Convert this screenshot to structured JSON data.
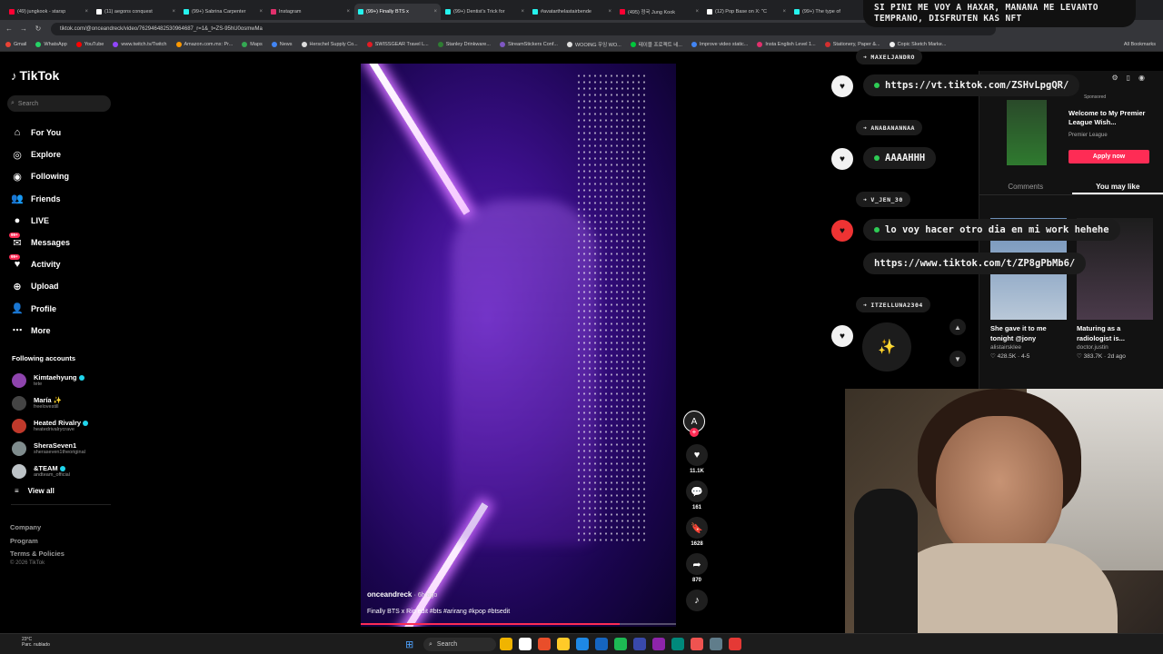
{
  "browser": {
    "tabs": [
      {
        "label": "(49) jungkook - starsp",
        "color": "#ff0033",
        "active": false
      },
      {
        "label": "(11) aegons conquest",
        "color": "#ffffff",
        "active": false
      },
      {
        "label": "(99+) Sabrina Carpenter",
        "color": "#25f4ee",
        "active": false
      },
      {
        "label": "Instagram",
        "color": "#e1306c",
        "active": false
      },
      {
        "label": "(99+) Finally BTS x",
        "color": "#25f4ee",
        "active": true
      },
      {
        "label": "(99+) Dentist's Trick for",
        "color": "#25f4ee",
        "active": false
      },
      {
        "label": "#avatarthelastairbende",
        "color": "#25f4ee",
        "active": false
      },
      {
        "label": "(495) 정국 Jung Kook",
        "color": "#ff0033",
        "active": false
      },
      {
        "label": "(12) Pop Base on X: \"C",
        "color": "#ffffff",
        "active": false
      },
      {
        "label": "(99+) The type of",
        "color": "#25f4ee",
        "active": false
      }
    ],
    "url": "tiktok.com/@onceandreck/video/762946482530964687_r=1&_t=ZS-95hU0osmwMa",
    "bookmarks": [
      {
        "label": "Gmail",
        "color": "#ea4335"
      },
      {
        "label": "WhatsApp",
        "color": "#25d366"
      },
      {
        "label": "YouTube",
        "color": "#ff0000"
      },
      {
        "label": "www.twitch.tv/Twitch",
        "color": "#9146ff"
      },
      {
        "label": "Amazon.com.mx: Pr...",
        "color": "#ff9900"
      },
      {
        "label": "Maps",
        "color": "#34a853"
      },
      {
        "label": "News",
        "color": "#4285f4"
      },
      {
        "label": "Herschel Supply Co...",
        "color": "#dddddd"
      },
      {
        "label": "SWISSGEAR Travel L...",
        "color": "#e31b23"
      },
      {
        "label": "Stanley Drinkware...",
        "color": "#2e7d32"
      },
      {
        "label": "StreamStickers Conf...",
        "color": "#7e57c2"
      },
      {
        "label": "WOOING 우잉 WO...",
        "color": "#e0e0e0"
      },
      {
        "label": "테이블 프로젝트 네...",
        "color": "#00c73c"
      },
      {
        "label": "Improve video static...",
        "color": "#4285f4"
      },
      {
        "label": "Insta English Level 1...",
        "color": "#e1306c"
      },
      {
        "label": "Stationery, Paper &...",
        "color": "#d32f2f"
      },
      {
        "label": "Copic Sketch Marke...",
        "color": "#eeeeee"
      }
    ],
    "all_bookmarks": "All Bookmarks"
  },
  "tiktok": {
    "logo": "TikTok",
    "search_placeholder": "Search",
    "menu": [
      {
        "label": "For You",
        "icon": "home-icon",
        "glyph": "⌂",
        "badge": ""
      },
      {
        "label": "Explore",
        "icon": "compass-icon",
        "glyph": "◎",
        "badge": ""
      },
      {
        "label": "Following",
        "icon": "following-icon",
        "glyph": "◉",
        "badge": ""
      },
      {
        "label": "Friends",
        "icon": "friends-icon",
        "glyph": "👥",
        "badge": ""
      },
      {
        "label": "LIVE",
        "icon": "live-icon",
        "glyph": "●",
        "badge": ""
      },
      {
        "label": "Messages",
        "icon": "messages-icon",
        "glyph": "✉",
        "badge": "99+"
      },
      {
        "label": "Activity",
        "icon": "activity-icon",
        "glyph": "♥",
        "badge": "99+"
      },
      {
        "label": "Upload",
        "icon": "upload-icon",
        "glyph": "⊕",
        "badge": ""
      },
      {
        "label": "Profile",
        "icon": "profile-icon",
        "glyph": "👤",
        "badge": ""
      },
      {
        "label": "More",
        "icon": "more-icon",
        "glyph": "⋯",
        "badge": ""
      }
    ],
    "following_title": "Following accounts",
    "accounts": [
      {
        "name": "Kimtaehyung",
        "handle": "tete",
        "verified": true,
        "color": "#8e44ad"
      },
      {
        "name": "María ✨",
        "handle": "freelovestill",
        "verified": false,
        "color": "#444444"
      },
      {
        "name": "Heated Rivalry",
        "handle": "heatedrivalrycrave",
        "verified": true,
        "color": "#c0392b"
      },
      {
        "name": "SheraSeven1",
        "handle": "sheraseven1theoriginal",
        "verified": false,
        "color": "#7f8c8d"
      },
      {
        "name": "&TEAM",
        "handle": "andteam_official",
        "verified": true,
        "color": "#bdc3c7"
      }
    ],
    "view_all": "View all",
    "footer": [
      "Company",
      "Program",
      "Terms & Policies"
    ],
    "copyright": "© 2026 TikTok",
    "video": {
      "author": "onceandreck",
      "ago": "· 6h ago",
      "caption": "Finally BTS x Rio edit #bts #arirang #kpop #btsedit",
      "progress": 0.82
    },
    "actions": [
      {
        "name": "like",
        "icon": "heart-icon",
        "glyph": "♥",
        "count": "11.1K"
      },
      {
        "name": "comment",
        "icon": "comment-icon",
        "glyph": "💬",
        "count": "161"
      },
      {
        "name": "bookmark",
        "icon": "bookmark-icon",
        "glyph": "🔖",
        "count": "1628"
      },
      {
        "name": "share",
        "icon": "share-icon",
        "glyph": "➦",
        "count": "870"
      }
    ]
  },
  "chat": {
    "top_message": "SI PINI ME VOY A HAXAR, MANANA ME LEVANTO TEMPRANO, DISFRUTEN KAS NFT",
    "entries": [
      {
        "user": "MAXELJANDRO",
        "message": "https://vt.tiktok.com/ZSHvLpgQR/"
      },
      {
        "user": "ANABANANNAA",
        "message": "AAAAHHH"
      },
      {
        "user": "V_JEN_30",
        "message": "lo voy hacer otro dia en mi work hehehe"
      },
      {
        "user": "",
        "message": "https://www.tiktok.com/t/ZP8gPbMb6/"
      },
      {
        "user": "ITZELLUNA2304",
        "message": ""
      }
    ]
  },
  "right_panel": {
    "sponsored": "Sponsored",
    "ad_title": "Welcome to My Premier League Wish...",
    "ad_sub": "Premier League",
    "apply": "Apply now",
    "tabs": [
      "Comments",
      "You may like"
    ],
    "recommendations": [
      {
        "title": "She gave it to me tonight @jony",
        "author": "alistairsklee",
        "stats": "♡ 428.5K · 4-5"
      },
      {
        "title": "Maturing as a radiologist is...",
        "author": "doctor.justin",
        "stats": "♡ 383.7K · 2d ago"
      }
    ]
  },
  "taskbar": {
    "weather_temp": "23°C",
    "weather_desc": "Parc. nublado",
    "search": "Search"
  }
}
